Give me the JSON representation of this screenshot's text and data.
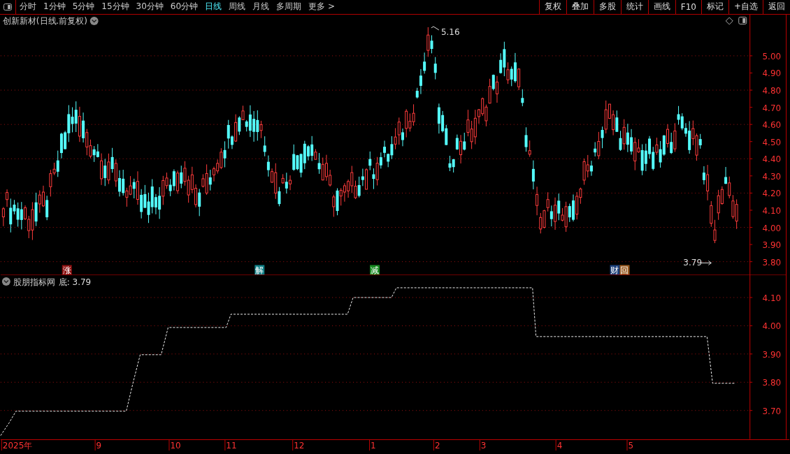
{
  "toolbar": {
    "periods": [
      {
        "label": "分时",
        "selected": false
      },
      {
        "label": "1分钟",
        "selected": false
      },
      {
        "label": "5分钟",
        "selected": false
      },
      {
        "label": "15分钟",
        "selected": false
      },
      {
        "label": "30分钟",
        "selected": false
      },
      {
        "label": "60分钟",
        "selected": false
      },
      {
        "label": "日线",
        "selected": true
      },
      {
        "label": "周线",
        "selected": false
      },
      {
        "label": "月线",
        "selected": false
      },
      {
        "label": "多周期",
        "selected": false
      },
      {
        "label": "更多 >",
        "selected": false
      }
    ],
    "actions": [
      "复权",
      "叠加",
      "多股",
      "统计",
      "画线",
      "F10",
      "标记",
      "+自选",
      "返回"
    ]
  },
  "chart": {
    "title": "创新新材(日线.前复权)",
    "high_label": "5.16",
    "low_label": "3.79",
    "y_labels": [
      "5.00",
      "4.90",
      "4.80",
      "4.70",
      "4.60",
      "4.50",
      "4.40",
      "4.30",
      "4.20",
      "4.10",
      "4.00",
      "3.90",
      "3.80"
    ],
    "markers": [
      {
        "text": "涨",
        "color": "#8b1010"
      },
      {
        "text": "解",
        "color": "#107f86"
      },
      {
        "text": "减",
        "color": "#188a20"
      },
      {
        "text": "财",
        "color": "#1c3f7a"
      },
      {
        "text": "回",
        "color": "#9a5a20"
      }
    ]
  },
  "indicator": {
    "title": "股朋指标网",
    "reading": "底: 3.79",
    "y_labels": [
      "4.10",
      "4.00",
      "3.90",
      "3.80",
      "3.70"
    ]
  },
  "dates": [
    "2025年",
    "9",
    "10",
    "11",
    "12",
    "1",
    "2",
    "3",
    "4",
    "5"
  ]
}
